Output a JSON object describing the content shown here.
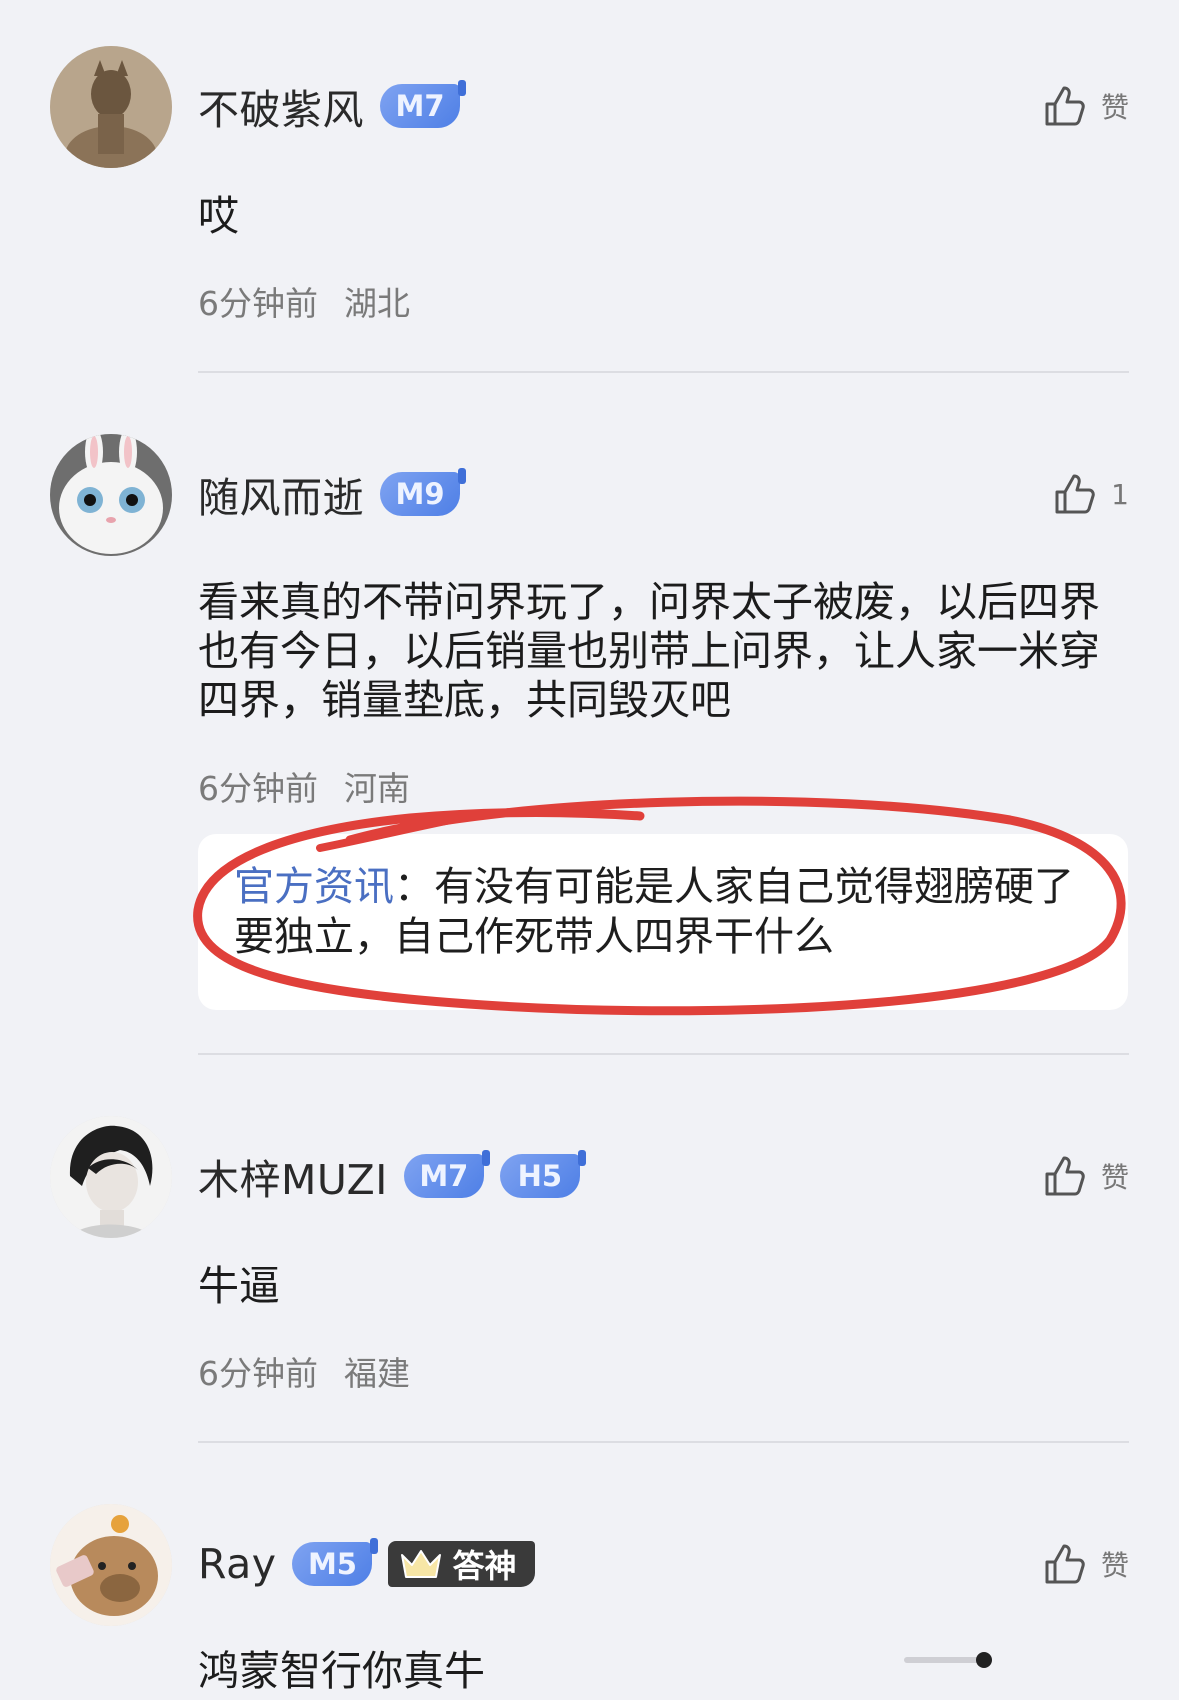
{
  "comments": [
    {
      "username": "不破紫风",
      "badges": [
        "M7"
      ],
      "like_label": "赞",
      "text": "哎",
      "time": "6分钟前",
      "location": "湖北",
      "avatar": "statue-avatar"
    },
    {
      "username": "随风而逝",
      "badges": [
        "M9"
      ],
      "like_label": "1",
      "text": "看来真的不带问界玩了，问界太子被废，以后四界也有今日，以后销量也别带上问界，让人家一米穿四界，销量垫底，共同毁灭吧",
      "time": "6分钟前",
      "location": "河南",
      "avatar": "white-rabbit-avatar",
      "reply": {
        "author": "官方资讯",
        "separator": "：",
        "text": "有没有可能是人家自己觉得翅膀硬了要独立，自己作死带人四界干什么"
      }
    },
    {
      "username": "木梓MUZI",
      "badges": [
        "M7",
        "H5"
      ],
      "like_label": "赞",
      "text": "牛逼",
      "time": "6分钟前",
      "location": "福建",
      "avatar": "anime-boy-avatar"
    },
    {
      "username": "Ray",
      "badges": [
        "M5"
      ],
      "special_badge": "答神",
      "like_label": "赞",
      "text": "鸿蒙智行你真牛",
      "avatar": "capybara-avatar"
    }
  ],
  "colors": {
    "background": "#f1f2f6",
    "badge_blue": "#5b86ea",
    "reply_author": "#4a6fc2",
    "highlight_ellipse": "#e0403a"
  }
}
